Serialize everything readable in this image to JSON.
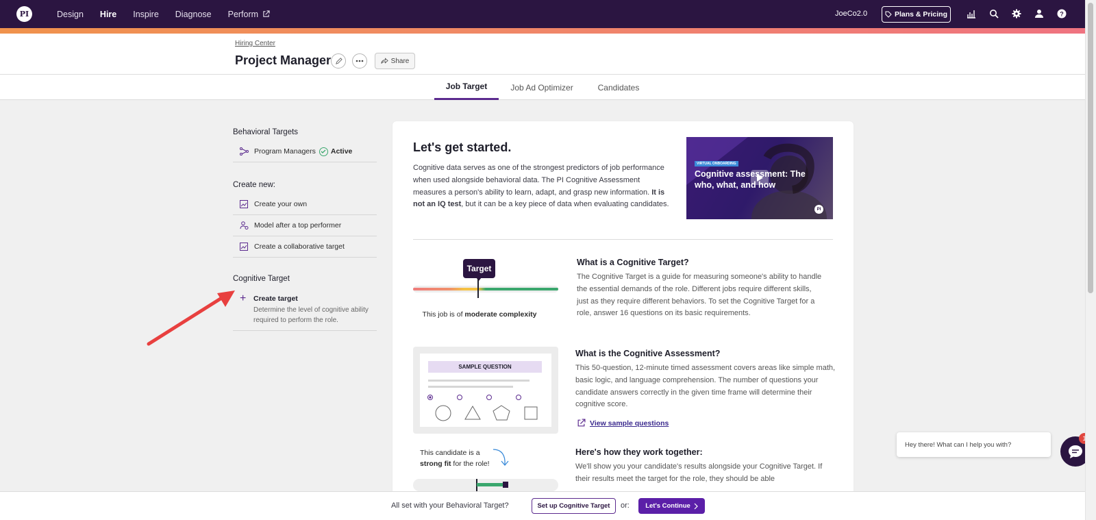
{
  "nav": {
    "logo": "PI",
    "links": [
      {
        "label": "Design"
      },
      {
        "label": "Hire"
      },
      {
        "label": "Inspire"
      },
      {
        "label": "Diagnose"
      },
      {
        "label": "Perform"
      }
    ],
    "org_name": "JoeCo2.0",
    "plans_label": "Plans & Pricing"
  },
  "header": {
    "breadcrumb": "Hiring Center",
    "title": "Project Manager",
    "share_label": "Share"
  },
  "tabs": [
    {
      "label": "Job Target"
    },
    {
      "label": "Job Ad Optimizer"
    },
    {
      "label": "Candidates"
    }
  ],
  "sidebar": {
    "behavioral_heading": "Behavioral Targets",
    "behavioral_item": "Program Managers",
    "behavioral_status": "Active",
    "create_heading": "Create new:",
    "create_items": [
      {
        "label": "Create your own"
      },
      {
        "label": "Model after a top performer"
      },
      {
        "label": "Create a collaborative target"
      }
    ],
    "cognitive_heading": "Cognitive Target",
    "create_target_title": "Create target",
    "create_target_desc": "Determine the level of cognitive ability required to perform the role."
  },
  "main": {
    "title": "Let's get started.",
    "intro_part1": "Cognitive data serves as one of the strongest predictors of job performance when used alongside behavioral data. The PI Cognitive Assessment measures a person's ability to learn, adapt, and grasp new information. ",
    "intro_bold": "It is not an IQ test",
    "intro_part2": ", but it can be a key piece of data when evaluating candidates.",
    "video_badge": "VIRTUAL ONBOARDING",
    "video_title": "Cognitive assessment: The who, what, and how",
    "video_logo": "PI",
    "target_bubble": "Target",
    "complexity_part1": "This job is of ",
    "complexity_bold": "moderate complexity",
    "q1_title": "What is a Cognitive Target?",
    "q1_text": "The Cognitive Target is a guide for measuring someone's ability to handle the essential demands of the role. Different jobs require different skills, just as they require different behaviors. To set the Cognitive Target for a role, answer 16 questions on its basic requirements.",
    "q2_title": "What is the Cognitive Assessment?",
    "q2_text": "This 50-question, 12-minute timed assessment covers areas like simple math, basic logic, and language comprehension. The number of questions your candidate answers correctly in the given time frame will determine their cognitive score.",
    "sample_label": "SAMPLE QUESTION",
    "sample_link": "View sample questions",
    "fit_part1": "This candidate is a ",
    "fit_bold": "strong fit",
    "fit_part2": " for the role!",
    "q3_title": "Here's how they work together:",
    "q3_text": "We'll show you your candidate's results alongside your Cognitive Target. If their results meet the target for the role, they should be able"
  },
  "bottom": {
    "prompt": "All set with your Behavioral Target?",
    "setup_label": "Set up Cognitive Target",
    "or": "or:",
    "continue_label": "Let's Continue"
  },
  "chat": {
    "message": "Hey there! What can I help you with?",
    "badge": "1"
  },
  "colors": {
    "nav_bg": "#2b1541",
    "accent": "#5b2a8e",
    "primary_button": "#5b1fa8",
    "success": "#3aa76d",
    "annotation_arrow": "#e8403f"
  }
}
